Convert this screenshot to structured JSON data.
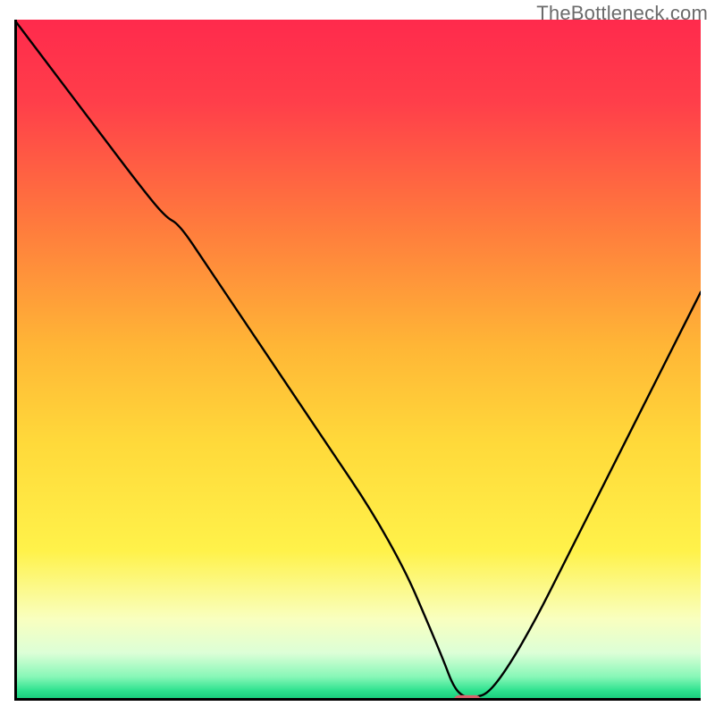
{
  "attribution": "TheBottleneck.com",
  "chart_data": {
    "type": "line",
    "title": "",
    "xlabel": "",
    "ylabel": "",
    "xlim": [
      0,
      100
    ],
    "ylim": [
      0,
      100
    ],
    "grid": false,
    "legend": false,
    "background_gradient_stops": [
      {
        "pos": 0.0,
        "color": "#ff2a4c"
      },
      {
        "pos": 0.12,
        "color": "#ff3e4a"
      },
      {
        "pos": 0.3,
        "color": "#ff7a3d"
      },
      {
        "pos": 0.48,
        "color": "#ffb636"
      },
      {
        "pos": 0.62,
        "color": "#ffd93a"
      },
      {
        "pos": 0.78,
        "color": "#fff24a"
      },
      {
        "pos": 0.88,
        "color": "#f9ffbf"
      },
      {
        "pos": 0.93,
        "color": "#dcffd7"
      },
      {
        "pos": 0.965,
        "color": "#87f7b7"
      },
      {
        "pos": 0.985,
        "color": "#2fe28f"
      },
      {
        "pos": 1.0,
        "color": "#12c877"
      }
    ],
    "series": [
      {
        "name": "bottleneck-curve",
        "color": "#000000",
        "x": [
          0,
          6,
          12,
          18,
          22,
          24,
          28,
          34,
          40,
          46,
          52,
          57,
          60,
          62.5,
          64,
          65.5,
          67,
          69,
          72,
          76,
          80,
          84,
          88,
          92,
          96,
          100
        ],
        "y": [
          100,
          92,
          84,
          76,
          71,
          70,
          64,
          55,
          46,
          37,
          28,
          19,
          12,
          6,
          2,
          0.5,
          0.5,
          1,
          5,
          12,
          20,
          28,
          36,
          44,
          52,
          60
        ]
      }
    ],
    "marker": {
      "label": "optimal-marker",
      "x": 66,
      "y": 0,
      "width_pct": 4.0,
      "height_pct": 1.6,
      "color": "#d9626c"
    },
    "axis_color": "#000000"
  }
}
